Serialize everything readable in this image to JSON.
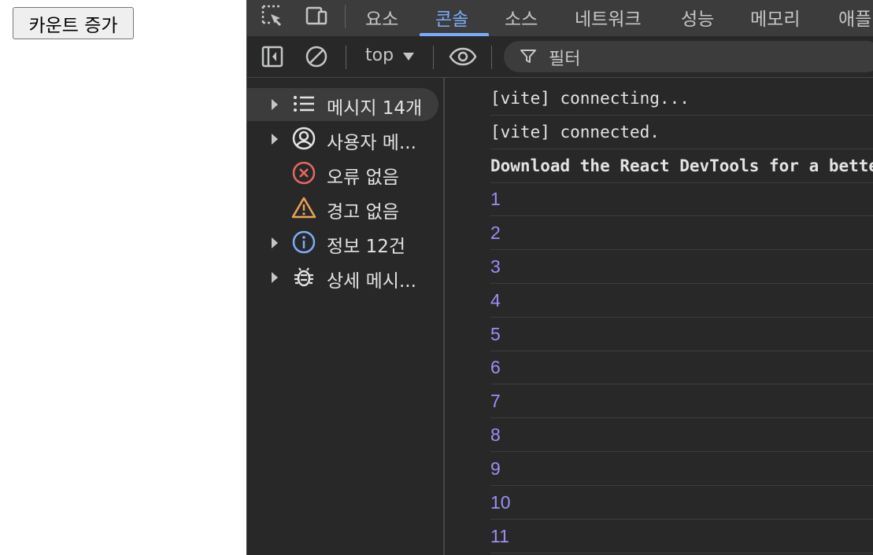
{
  "page": {
    "button_label": "카운트 증가"
  },
  "devtools": {
    "tabs": [
      "요소",
      "콘솔",
      "소스",
      "네트워크",
      "성능",
      "메모리",
      "애플"
    ],
    "active_tab": "콘솔",
    "context": "top",
    "filter_placeholder": "필터",
    "sidebar": [
      {
        "label": "메시지 14개",
        "icon": "list-icon",
        "expandable": true,
        "selected": true
      },
      {
        "label": "사용자 메...",
        "icon": "user-icon",
        "expandable": true
      },
      {
        "label": "오류 없음",
        "icon": "error-icon",
        "expandable": false
      },
      {
        "label": "경고 없음",
        "icon": "warning-icon",
        "expandable": false
      },
      {
        "label": "정보 12건",
        "icon": "info-icon",
        "expandable": true
      },
      {
        "label": "상세 메시...",
        "icon": "bug-icon",
        "expandable": true
      }
    ],
    "messages": [
      {
        "text": "[vite] connecting...",
        "style": "log"
      },
      {
        "text": "[vite] connected.",
        "style": "log"
      },
      {
        "text": "Download the React DevTools for a better development experience",
        "style": "bold"
      },
      {
        "text": "1",
        "style": "number"
      },
      {
        "text": "2",
        "style": "number"
      },
      {
        "text": "3",
        "style": "number"
      },
      {
        "text": "4",
        "style": "number"
      },
      {
        "text": "5",
        "style": "number"
      },
      {
        "text": "6",
        "style": "number"
      },
      {
        "text": "7",
        "style": "number"
      },
      {
        "text": "8",
        "style": "number"
      },
      {
        "text": "9",
        "style": "number"
      },
      {
        "text": "10",
        "style": "number"
      },
      {
        "text": "11",
        "style": "number"
      }
    ],
    "colors": {
      "accent": "#7cacf8",
      "number": "#9b8ff5",
      "error": "#e46962",
      "warning": "#e8a35b",
      "info": "#7cacf8"
    }
  }
}
